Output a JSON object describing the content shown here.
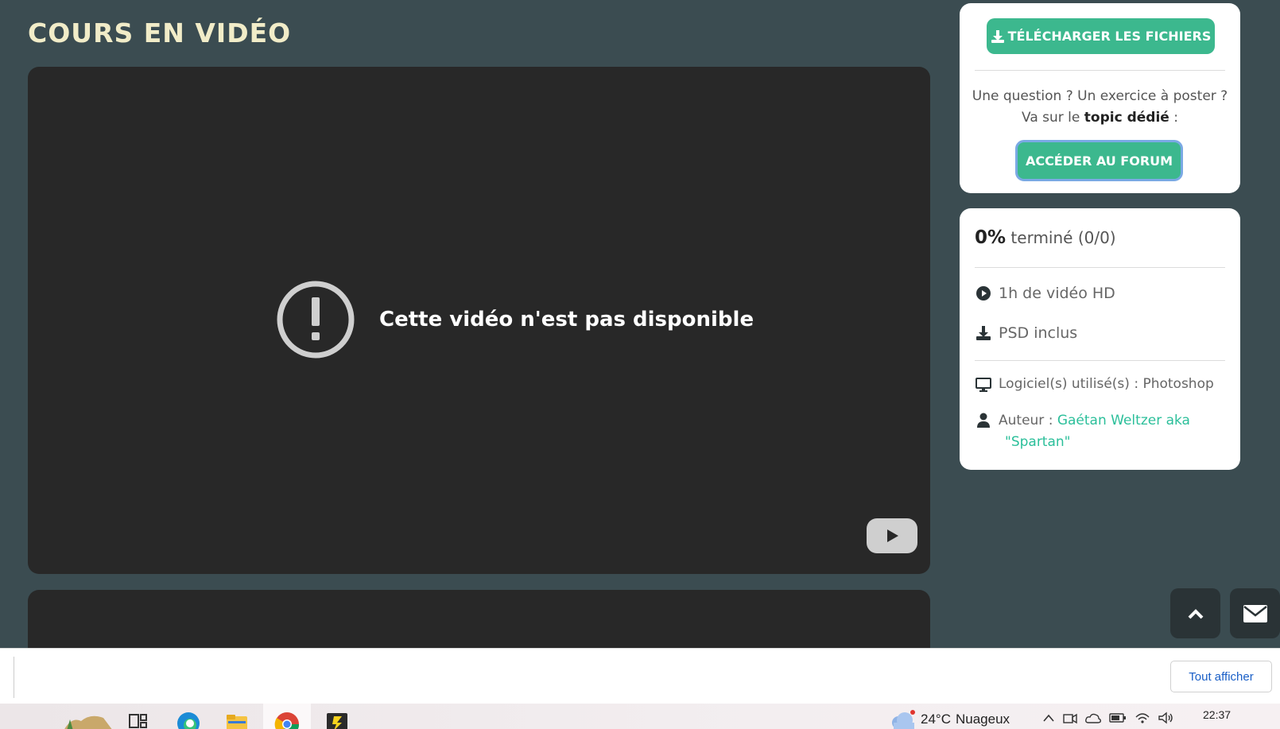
{
  "page": {
    "title": "COURS EN VIDÉO"
  },
  "video": {
    "error_message": "Cette vidéo n'est pas disponible",
    "error_icon": "alert-circle-icon",
    "logo_icon": "youtube-play-icon"
  },
  "sidebar": {
    "download_button": {
      "label": "TÉLÉCHARGER LES FICHIERS",
      "icon": "download-icon"
    },
    "question": {
      "line1": "Une question ? Un exercice à poster ?",
      "line2_prefix": "Va sur le",
      "line2_bold": "topic dédié",
      "line2_suffix": ":"
    },
    "forum_button": {
      "label": "ACCÉDER AU FORUM"
    },
    "progress": {
      "percent": "0%",
      "label": "terminé (0/0)"
    },
    "features": [
      {
        "icon": "play-circle-icon",
        "text": "1h de vidéo HD"
      },
      {
        "icon": "download-icon",
        "text": "PSD inclus"
      }
    ],
    "software": {
      "icon": "monitor-icon",
      "text": "Logiciel(s) utilisé(s) : Photoshop"
    },
    "author": {
      "icon": "user-icon",
      "label": "Auteur :",
      "name_line1": "Gaétan Weltzer aka",
      "name_line2": "\"Spartan\""
    }
  },
  "floating": {
    "scroll_top_icon": "chevron-up-icon",
    "mail_icon": "envelope-icon"
  },
  "download_bar": {
    "show_all_label": "Tout afficher"
  },
  "taskbar": {
    "weather": {
      "temp": "24°C",
      "desc": "Nuageux",
      "icon": "cloud-icon"
    },
    "clock": "22:37",
    "apps": [
      "widgets-icon",
      "task-view-icon",
      "edge-icon",
      "file-explorer-icon",
      "chrome-icon",
      "app-icon"
    ]
  },
  "colors": {
    "background": "#3b4c51",
    "accent": "#3cb88e",
    "title": "#f1ecc8",
    "link": "#2bbf9a"
  }
}
